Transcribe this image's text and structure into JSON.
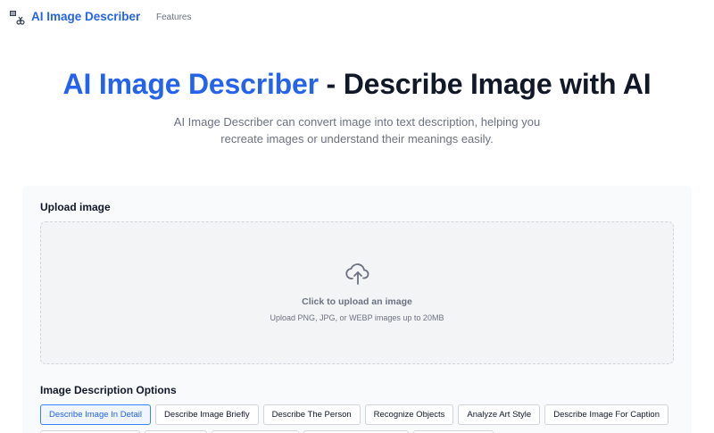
{
  "nav": {
    "brand": "AI Image Describer",
    "links": [
      "Features"
    ],
    "logo_icon": "image-scissors-icon"
  },
  "hero": {
    "title_accent": "AI Image Describer",
    "title_rest": " - Describe Image with AI",
    "subtitle": "AI Image Describer can convert image into text description, helping you recreate images or understand their meanings easily."
  },
  "upload": {
    "label": "Upload image",
    "title": "Click to upload an image",
    "hint": "Upload PNG, JPG, or WEBP images up to 20MB",
    "icon": "cloud-upload-icon"
  },
  "options": {
    "label": "Image Description Options",
    "items": [
      "Describe Image In Detail",
      "Describe Image Briefly",
      "Describe The Person",
      "Recognize Objects",
      "Analyze Art Style",
      "Describe Image For Caption"
    ],
    "selected": "Describe Image In Detail"
  },
  "colors": {
    "accent": "#2563eb",
    "text": "#111827",
    "muted": "#6b7280",
    "panel": "#f9fafb"
  }
}
